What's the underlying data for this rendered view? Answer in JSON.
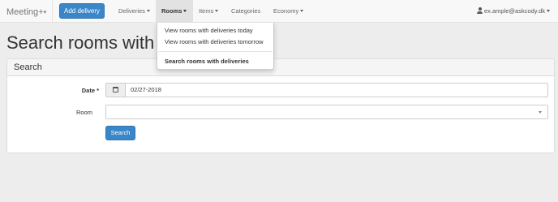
{
  "navbar": {
    "brand": "Meeting+",
    "brand_caret": "▾",
    "add_delivery": "Add delivery",
    "menu": [
      {
        "label": "Deliveries"
      },
      {
        "label": "Rooms"
      },
      {
        "label": "Items"
      },
      {
        "label": "Categories"
      },
      {
        "label": "Economy"
      }
    ],
    "user": "ex.ample@askcody.dk"
  },
  "dropdown": {
    "items": [
      "View rooms with deliveries today",
      "View rooms with deliveries tomorrow",
      "Search rooms with deliveries"
    ]
  },
  "page": {
    "title": "Search rooms with deliveries"
  },
  "panel": {
    "heading": "Search",
    "date_label": "Date *",
    "date_value": "02/27-2018",
    "room_label": "Room",
    "room_value": "",
    "search_button": "Search"
  }
}
